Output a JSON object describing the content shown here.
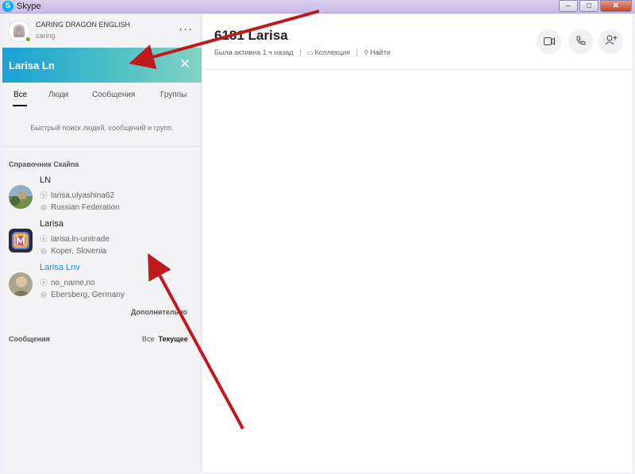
{
  "window": {
    "title": "Skype",
    "app_icon": "skype-logo-icon",
    "buttons": [
      "minimize",
      "maximize",
      "close"
    ]
  },
  "profile": {
    "name": "CARING DRAGON ENGLISH",
    "mood": "caring",
    "status_color": "#6bb700",
    "more_label": "···"
  },
  "search": {
    "value": "Larisa Ln",
    "clear_icon": "close-icon"
  },
  "tabs": [
    {
      "label": "Все",
      "active": true
    },
    {
      "label": "Люди",
      "active": false
    },
    {
      "label": "Сообщения",
      "active": false
    },
    {
      "label": "Группы",
      "active": false
    }
  ],
  "hint": "Быстрый поиск людей, сообщений и групп.",
  "directory": {
    "title": "Справочник Скайпа",
    "results": [
      {
        "name": "LN",
        "skype_id": "larisa.ulyashina62",
        "location": "Russian Federation"
      },
      {
        "name": "Larisa",
        "skype_id": "larisa.ln-unitrade",
        "location": "Koper, Slovenia"
      },
      {
        "name": "Larisa Lnv",
        "skype_id": "no_name,no",
        "location": "Ebersberg, Germany"
      }
    ],
    "more_label": "Дополнительно"
  },
  "messages": {
    "title": "Сообщения",
    "filter_all": "Все",
    "filter_current": "Текущее"
  },
  "chat": {
    "title": "6181 Larisa",
    "last_seen": "Была активна 1 ч назад",
    "gallery": "Коллекция",
    "find": "Найти",
    "actions": [
      "video-call-icon",
      "audio-call-icon",
      "add-person-icon"
    ]
  },
  "colors": {
    "accent": "#1aa1d6",
    "arrow": "#c0191c",
    "link": "#1a8fd6"
  }
}
